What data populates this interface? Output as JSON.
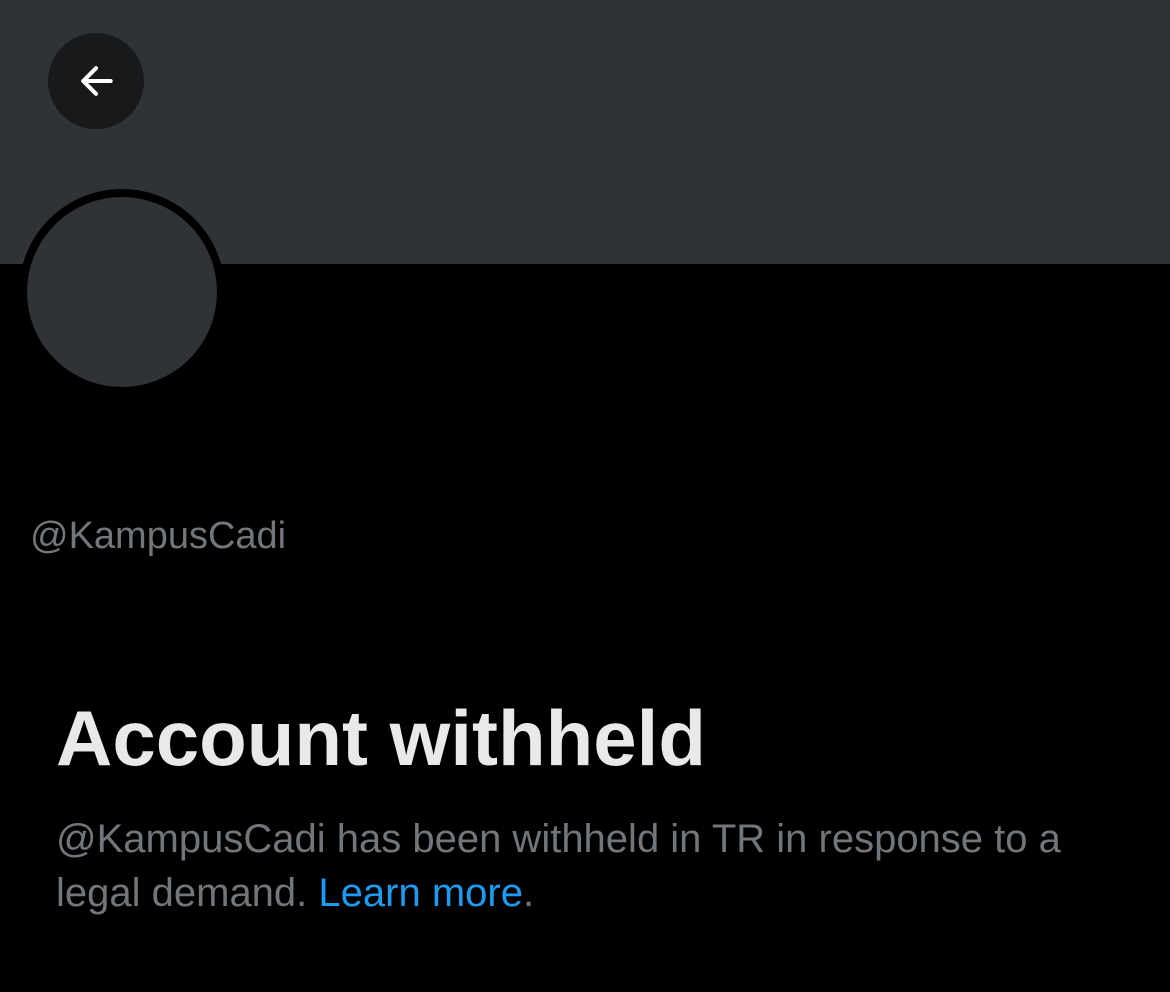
{
  "header": {
    "back_icon": "arrow-left-icon"
  },
  "profile": {
    "handle": "@KampusCadi"
  },
  "withheld_notice": {
    "title": "Account withheld",
    "message": "@KampusCadi has been withheld in TR in response to a legal demand. ",
    "link_label": "Learn more",
    "trailing": "."
  },
  "colors": {
    "background": "#000000",
    "banner": "#2f3336",
    "secondary_text": "#71767b",
    "primary_text": "#e7e9ea",
    "link": "#1d9bf0"
  }
}
